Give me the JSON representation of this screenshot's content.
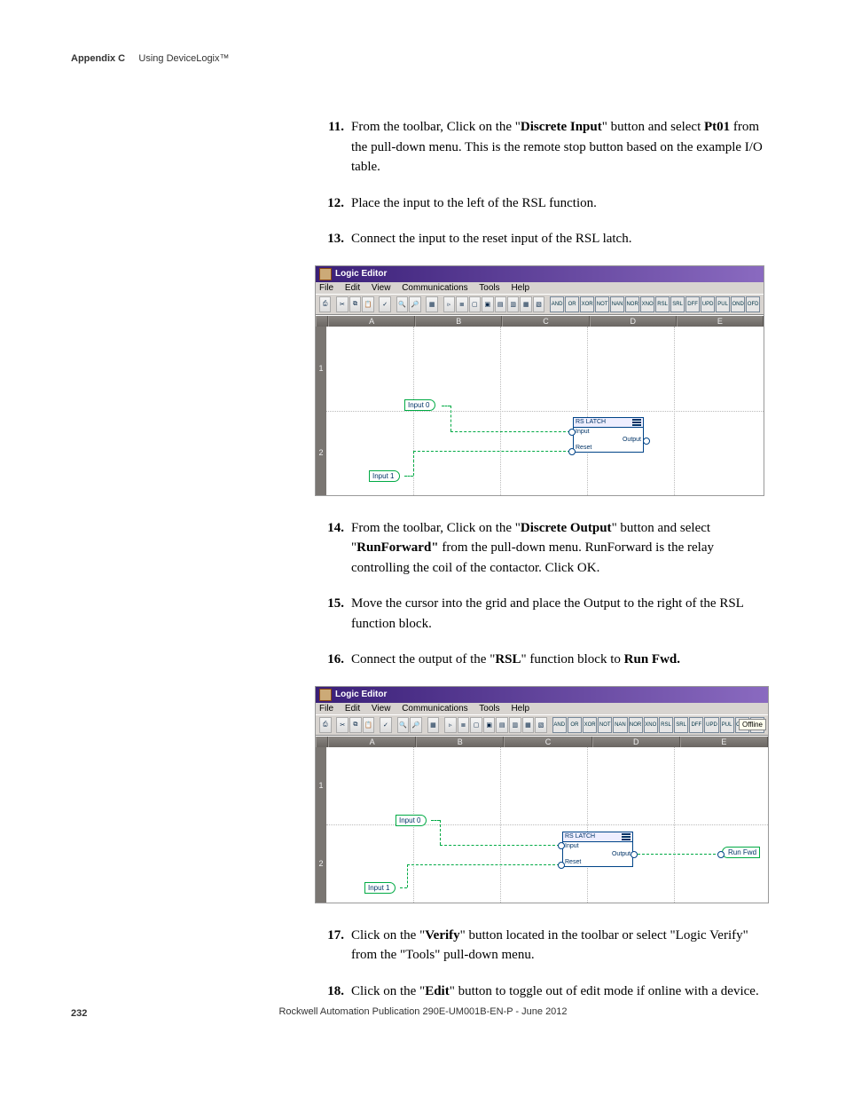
{
  "header": {
    "appendix": "Appendix C",
    "title": "Using DeviceLogix™"
  },
  "steps": {
    "s11": {
      "num": "11.",
      "pre": "From the toolbar, Click on the \"",
      "bold1": "Discrete Input",
      "mid1": "\" button and select ",
      "bold2": "Pt01",
      "post": " from the pull-down menu. This is the remote stop button based on the example I/O table."
    },
    "s12": {
      "num": "12.",
      "text": "Place the input to the left of the RSL function."
    },
    "s13": {
      "num": "13.",
      "text": "Connect the input to the reset input of the RSL latch."
    },
    "s14": {
      "num": "14.",
      "pre": "From the toolbar, Click on the \"",
      "bold1": "Discrete Output",
      "mid1": "\" button and select \"",
      "bold2": "RunForward\"",
      "post": " from the pull-down menu. RunForward is the relay controlling the coil of the contactor. Click OK."
    },
    "s15": {
      "num": "15.",
      "text": "Move the cursor into the grid and place the Output to the right of the RSL function block."
    },
    "s16": {
      "num": "16.",
      "pre": "Connect the output of the \"",
      "bold1": "RSL",
      "mid1": "\" function block to ",
      "bold2": "Run Fwd.",
      "post": ""
    },
    "s17": {
      "num": "17.",
      "pre": "Click on the \"",
      "bold1": "Verify",
      "post": "\" button located in the toolbar or select \"Logic Verify\" from the \"Tools\" pull-down menu."
    },
    "s18": {
      "num": "18.",
      "pre": "Click on the \"",
      "bold1": "Edit",
      "post": "\" button to toggle out of edit mode if online with a device."
    }
  },
  "editor": {
    "title": "Logic Editor",
    "menus": [
      "File",
      "Edit",
      "View",
      "Communications",
      "Tools",
      "Help"
    ],
    "columns": [
      "A",
      "B",
      "C",
      "D",
      "E"
    ],
    "rows": [
      "1",
      "2"
    ],
    "logic_buttons": [
      "AND",
      "OR",
      "XOR",
      "NOT",
      "NAN",
      "NOR",
      "XNO",
      "RSL",
      "SRL",
      "DFF",
      "UPD",
      "PUL",
      "OND",
      "OFD"
    ],
    "input0": "Input 0",
    "input1": "Input 1",
    "rsl_title": "RS LATCH",
    "rsl_input": "Input",
    "rsl_output": "Output",
    "rsl_reset": "Reset",
    "run_fwd": "Run Fwd",
    "offline": "Offline"
  },
  "footer": {
    "page": "232",
    "pub": "Rockwell Automation Publication 290E-UM001B-EN-P - June 2012"
  }
}
